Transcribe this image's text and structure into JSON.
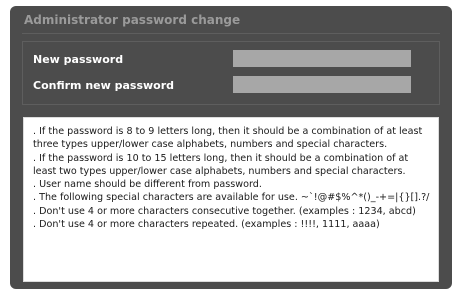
{
  "dialog": {
    "title": "Administrator password change"
  },
  "form": {
    "new_password_label": "New password",
    "confirm_password_label": "Confirm new password",
    "new_password_value": "",
    "confirm_password_value": ""
  },
  "notes": [
    ". If the password is 8 to 9 letters long, then it should be a combination of at least three types upper/lower case alphabets, numbers and special characters.",
    ". If the password is 10 to 15 letters long, then it should be a combination of at least two types upper/lower case alphabets, numbers and special characters.",
    ". User name should be different from password.",
    ". The following special characters are available for use. ~`!@#$%^*()_-+=|{}[].?/",
    ". Don't use 4 or more characters consecutive together. (examples : 1234, abcd)",
    ". Don't use 4 or more characters repeated. (examples : !!!!, 1111, aaaa)"
  ]
}
